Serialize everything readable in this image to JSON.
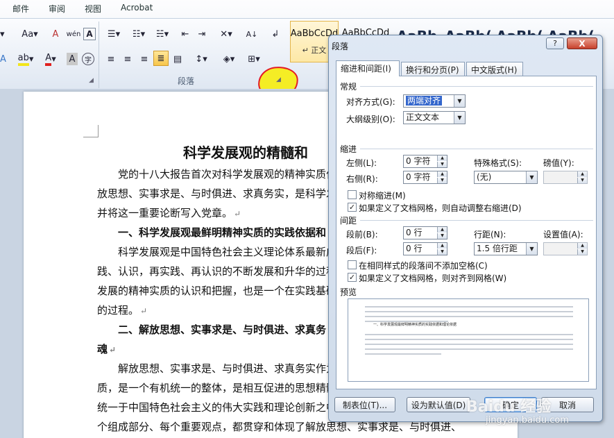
{
  "ribbon": {
    "tabs": [
      "邮件",
      "审阅",
      "视图",
      "Acrobat"
    ],
    "paragraph_group_label": "段落",
    "buttons": {
      "font_case": "Aa",
      "clear_format": "A",
      "phonetic": "wén",
      "char_border": "A",
      "sort": "A↓",
      "char_shading": "A",
      "enclose_char": "字"
    }
  },
  "styles_gallery": {
    "items": [
      {
        "sample": "AaBbCcDd",
        "name": "↵ 正文"
      },
      {
        "sample": "AaBbCcDd",
        "name": ""
      },
      {
        "sample": "AaBb",
        "name": ""
      },
      {
        "sample": "AaBb(",
        "name": ""
      },
      {
        "sample": "AaBb(",
        "name": ""
      },
      {
        "sample": "AaBb(",
        "name": ""
      }
    ]
  },
  "document": {
    "title": "科学发展观的精髓和",
    "paragraph_mark": "↵",
    "lines": [
      {
        "text": "党的十八大报告首次对科学发展观的精神实质作",
        "mark": false,
        "bold": false
      },
      {
        "text": "放思想、实事求是、与时俱进、求真务实，是科学发",
        "mark": false,
        "bold": false
      },
      {
        "text": "并将这一重要论断写入党章。",
        "mark": true,
        "bold": false
      },
      {
        "text": "一、科学发展观最鲜明精神实质的实践依据和",
        "mark": false,
        "bold": true
      },
      {
        "text": "科学发展观是中国特色社会主义理论体系最新成",
        "mark": false,
        "bold": false
      },
      {
        "text": "践、认识，再实践、再认识的不断发展和升华的过程",
        "mark": false,
        "bold": false
      },
      {
        "text": "发展的精神实质的认识和把握，也是一个在实践基础",
        "mark": false,
        "bold": false
      },
      {
        "text": "的过程。",
        "mark": true,
        "bold": false
      },
      {
        "text": "二、解放思想、实事求是、与时俱进、求真务",
        "mark": false,
        "bold": true
      },
      {
        "text": "魂",
        "mark": true,
        "bold": true
      },
      {
        "text": "解放思想、实事求是、与时俱进、求真务实作为",
        "mark": false,
        "bold": false
      },
      {
        "text": "质，是一个有机统一的整体，是相互促进的思想精髓",
        "mark": false,
        "bold": false
      },
      {
        "text": "统一于中国特色社会主义的伟大实践和理论创新之中",
        "mark": false,
        "bold": false
      },
      {
        "text": "个组成部分、每个重要观点，都贯穿和体现了解放思想、实事求是、与时俱进、",
        "mark": false,
        "bold": false
      }
    ]
  },
  "dialog": {
    "title": "段落",
    "help_label": "?",
    "close_label": "X",
    "tabs": [
      "缩进和间距(I)",
      "换行和分页(P)",
      "中文版式(H)"
    ],
    "general": {
      "section_label": "常规",
      "alignment_label": "对齐方式(G):",
      "alignment_value": "两端对齐",
      "outline_label": "大纲级别(O):",
      "outline_value": "正文文本"
    },
    "indent": {
      "section_label": "缩进",
      "left_label": "左侧(L):",
      "left_value": "0 字符",
      "right_label": "右侧(R):",
      "right_value": "0 字符",
      "special_label": "特殊格式(S):",
      "special_value": "(无)",
      "measure_label": "磅值(Y):",
      "measure_value": "",
      "mirror_label": "对称缩进(M)",
      "mirror_checked": false,
      "auto_adjust_label": "如果定义了文档网格，则自动调整右缩进(D)",
      "auto_adjust_checked": true
    },
    "spacing": {
      "section_label": "间距",
      "before_label": "段前(B):",
      "before_value": "0 行",
      "after_label": "段后(F):",
      "after_value": "0 行",
      "line_label": "行距(N):",
      "line_value": "1.5 倍行距",
      "at_label": "设置值(A):",
      "at_value": "",
      "no_space_label": "在相同样式的段落间不添加空格(C)",
      "no_space_checked": false,
      "snap_grid_label": "如果定义了文档网格，则对齐到网格(W)",
      "snap_grid_checked": true
    },
    "preview": {
      "section_label": "预览",
      "sample_text": "一、科学发展观最鲜明精神实质的实践依据和理论依据"
    },
    "buttons": {
      "tabs": "制表位(T)...",
      "set_default": "设为默认值(D)",
      "ok": "确定",
      "cancel": "取消"
    }
  },
  "watermark": {
    "brand": "Baidu 经验",
    "url": "jingyan.baidu.com"
  }
}
